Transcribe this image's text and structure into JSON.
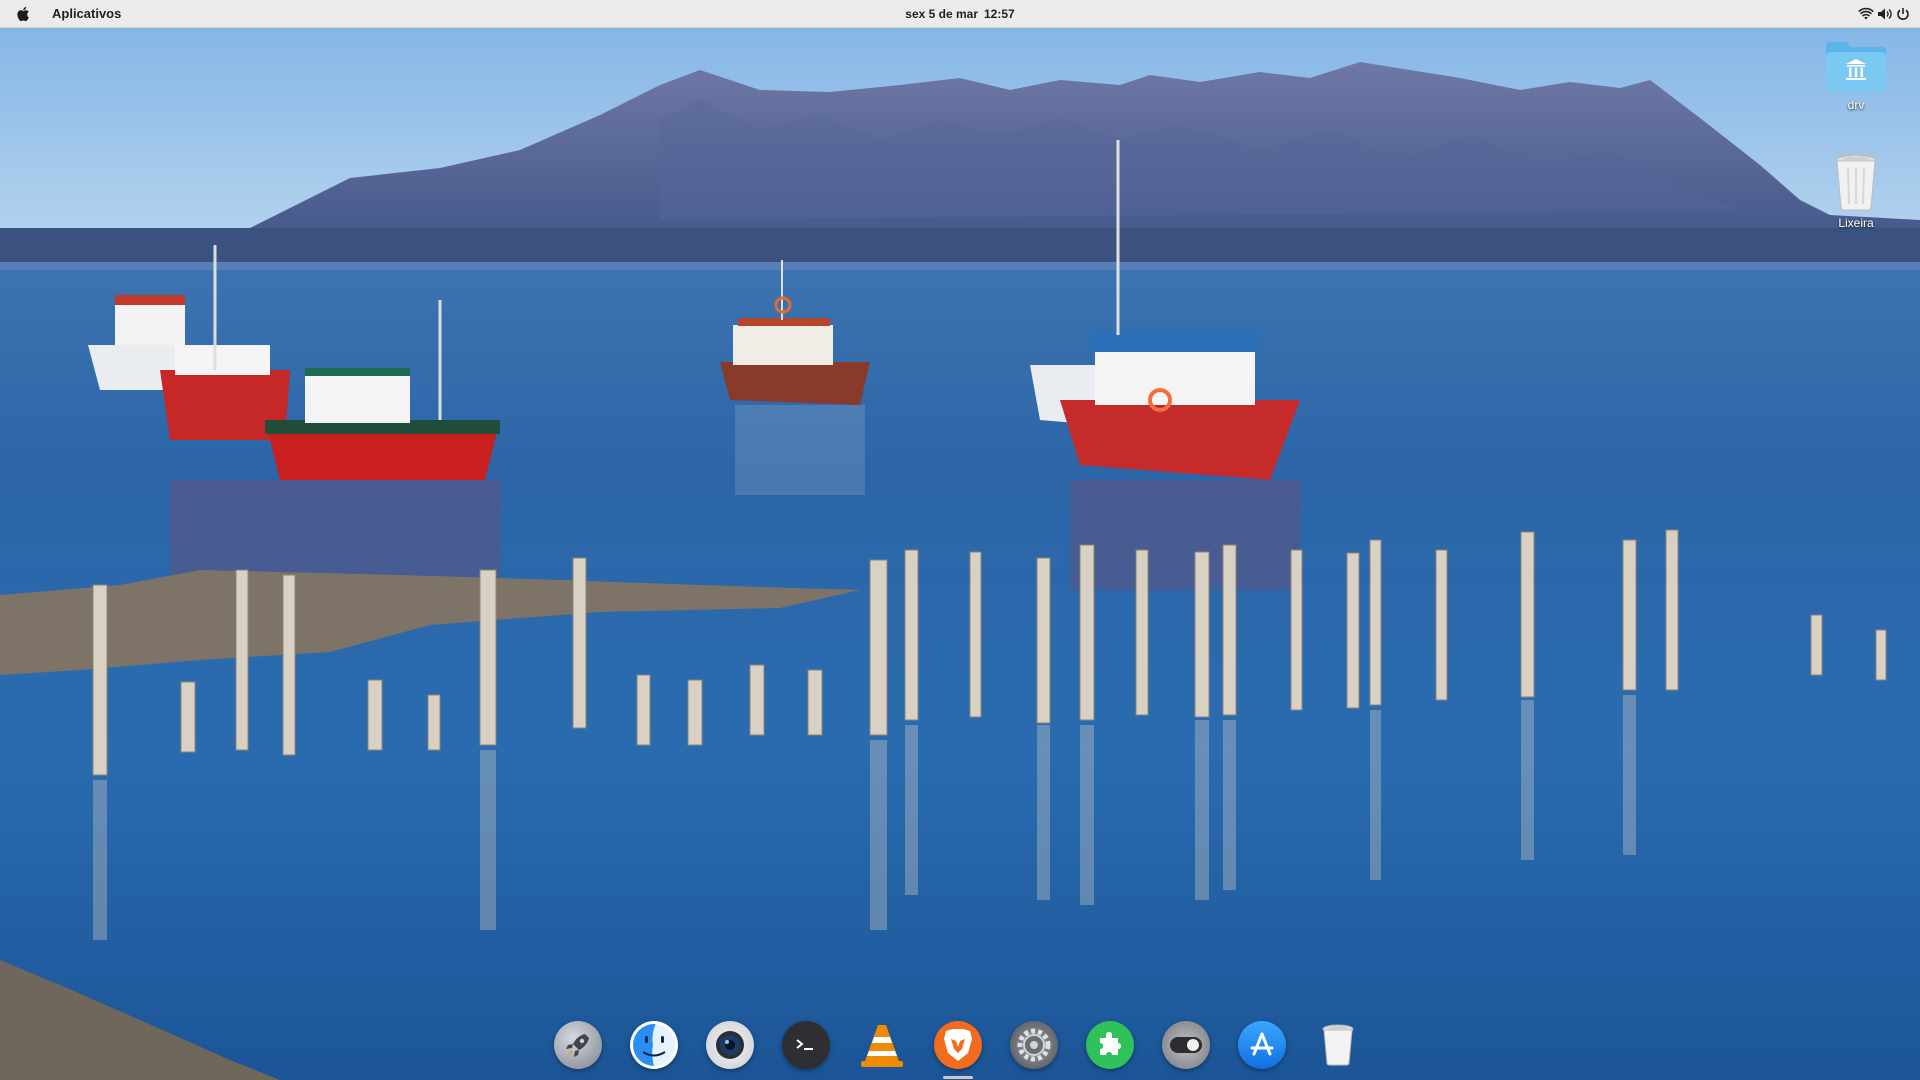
{
  "topbar": {
    "apple_menu_icon": "apple-logo-icon",
    "apps_label": "Aplicativos",
    "clock_date": "sex 5 de mar",
    "clock_time": "12:57",
    "indicators": [
      "wifi-icon",
      "volume-icon",
      "power-icon"
    ]
  },
  "desktop": {
    "icons": [
      {
        "name": "drv",
        "icon": "network-drive-folder-icon"
      },
      {
        "name": "Lixeira",
        "icon": "trash-icon"
      }
    ]
  },
  "dock": {
    "apps": [
      {
        "id": "launchpad",
        "icon": "rocket-icon",
        "color": "#8a8f99"
      },
      {
        "id": "finder",
        "icon": "finder-face-icon",
        "color": "#2b8df2"
      },
      {
        "id": "camera",
        "icon": "camera-lens-icon",
        "color": "#cfd2d6"
      },
      {
        "id": "terminal",
        "icon": "terminal-prompt-icon",
        "color": "#2e2e33"
      },
      {
        "id": "vlc",
        "icon": "traffic-cone-icon",
        "color": "#f08a00"
      },
      {
        "id": "brave",
        "icon": "lion-shield-icon",
        "color": "#f36b1c"
      },
      {
        "id": "settings",
        "icon": "gear-icon",
        "color": "#5c5f66"
      },
      {
        "id": "extensions",
        "icon": "puzzle-piece-icon",
        "color": "#2fc25b"
      },
      {
        "id": "tweaks",
        "icon": "toggle-switch-icon",
        "color": "#8d8f94"
      },
      {
        "id": "app-store",
        "icon": "app-store-a-icon",
        "color": "#1e8ef0"
      },
      {
        "id": "trash",
        "icon": "trash-icon",
        "color": "#e8e8e8"
      }
    ],
    "running": "brave"
  },
  "colors": {
    "topbar": "#eceaea",
    "sky": "#8fbde8",
    "mountains": "#4e5f92",
    "water": "#1d5fa3"
  }
}
